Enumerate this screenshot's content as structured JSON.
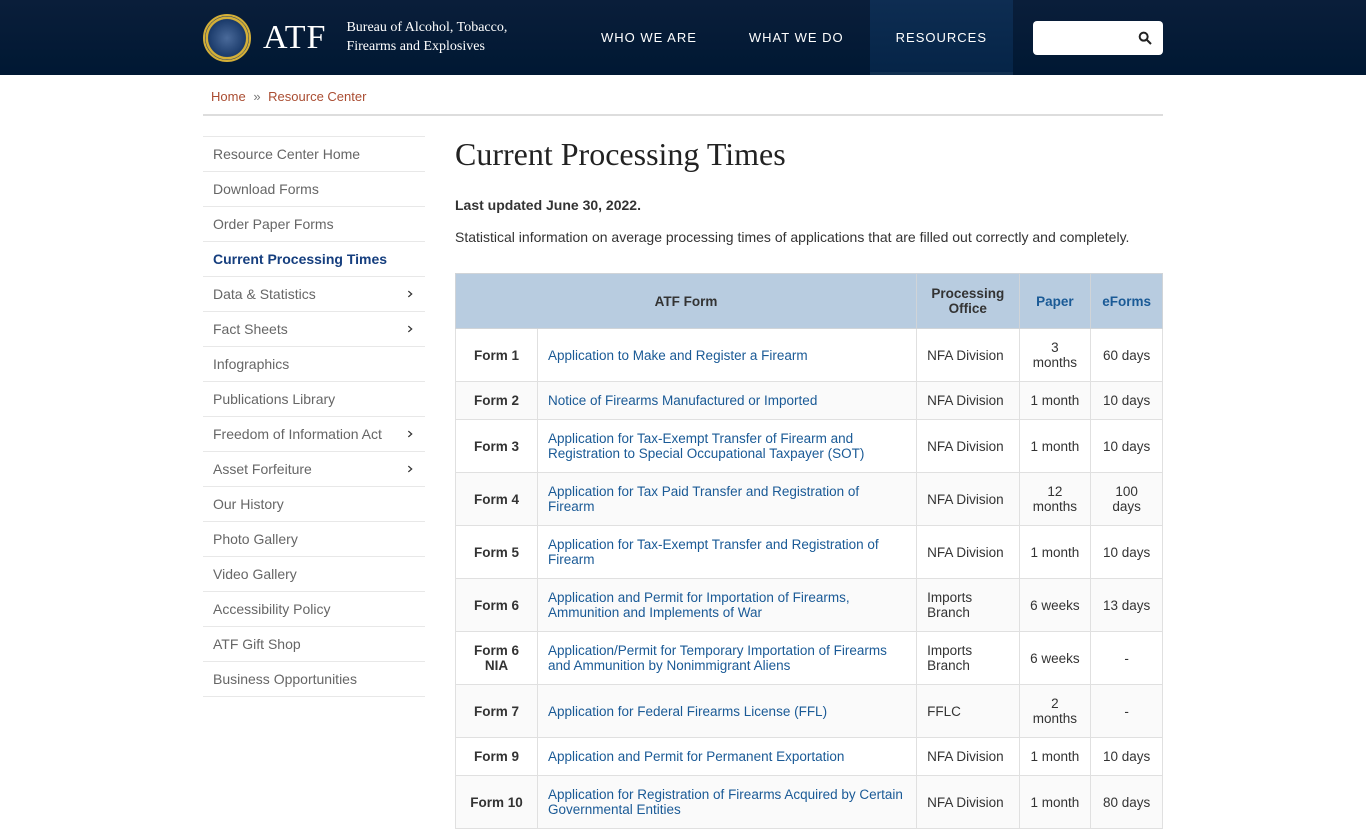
{
  "header": {
    "atf": "ATF",
    "bureau_line1": "Bureau of Alcohol, Tobacco,",
    "bureau_line2": "Firearms and Explosives",
    "nav": [
      {
        "label": "WHO WE ARE",
        "active": false
      },
      {
        "label": "WHAT WE DO",
        "active": false
      },
      {
        "label": "RESOURCES",
        "active": true
      }
    ],
    "search_placeholder": ""
  },
  "breadcrumb": {
    "home": "Home",
    "sep": "»",
    "current": "Resource Center"
  },
  "sidebar": {
    "items": [
      {
        "label": "Resource Center Home",
        "expand": false,
        "active": false
      },
      {
        "label": "Download Forms",
        "expand": false,
        "active": false
      },
      {
        "label": "Order Paper Forms",
        "expand": false,
        "active": false
      },
      {
        "label": "Current Processing Times",
        "expand": false,
        "active": true
      },
      {
        "label": "Data & Statistics",
        "expand": true,
        "active": false
      },
      {
        "label": "Fact Sheets",
        "expand": true,
        "active": false
      },
      {
        "label": "Infographics",
        "expand": false,
        "active": false
      },
      {
        "label": "Publications Library",
        "expand": false,
        "active": false
      },
      {
        "label": "Freedom of Information Act",
        "expand": true,
        "active": false
      },
      {
        "label": "Asset Forfeiture",
        "expand": true,
        "active": false
      },
      {
        "label": "Our History",
        "expand": false,
        "active": false
      },
      {
        "label": "Photo Gallery",
        "expand": false,
        "active": false
      },
      {
        "label": "Video Gallery",
        "expand": false,
        "active": false
      },
      {
        "label": "Accessibility Policy",
        "expand": false,
        "active": false
      },
      {
        "label": "ATF Gift Shop",
        "expand": false,
        "active": false
      },
      {
        "label": "Business Opportunities",
        "expand": false,
        "active": false
      }
    ]
  },
  "main": {
    "title": "Current Processing Times",
    "updated": "Last updated June 30, 2022.",
    "intro": "Statistical information on average processing times of applications that are filled out correctly and completely.",
    "columns": {
      "form": "ATF Form",
      "office": "Processing Office",
      "paper": "Paper",
      "eforms": "eForms"
    },
    "rows": [
      {
        "id": "Form 1",
        "desc": "Application to Make and Register a Firearm",
        "office": "NFA Division",
        "paper": "3 months",
        "eform": "60 days"
      },
      {
        "id": "Form 2",
        "desc": "Notice of Firearms Manufactured or Imported",
        "office": "NFA Division",
        "paper": "1 month",
        "eform": "10 days"
      },
      {
        "id": "Form 3",
        "desc": "Application for Tax-Exempt Transfer of Firearm and Registration to Special Occupational Taxpayer (SOT)",
        "office": "NFA Division",
        "paper": "1 month",
        "eform": "10 days"
      },
      {
        "id": "Form 4",
        "desc": "Application for Tax Paid Transfer and Registration of Firearm",
        "office": "NFA Division",
        "paper": "12 months",
        "eform": "100 days"
      },
      {
        "id": "Form 5",
        "desc": "Application for Tax-Exempt Transfer and Registration of Firearm",
        "office": "NFA Division",
        "paper": "1 month",
        "eform": "10 days"
      },
      {
        "id": "Form 6",
        "desc": "Application and Permit for Importation of Firearms, Ammunition and Implements of War",
        "office": "Imports Branch",
        "paper": "6 weeks",
        "eform": "13 days"
      },
      {
        "id": "Form 6 NIA",
        "desc": "Application/Permit for Temporary Importation of Firearms and Ammunition by Nonimmigrant Aliens",
        "office": "Imports Branch",
        "paper": "6 weeks",
        "eform": "-"
      },
      {
        "id": "Form 7",
        "desc": "Application for Federal Firearms License (FFL)",
        "office": "FFLC",
        "paper": "2 months",
        "eform": "-"
      },
      {
        "id": "Form 9",
        "desc": "Application and Permit for Permanent Exportation",
        "office": "NFA Division",
        "paper": "1 month",
        "eform": "10 days"
      },
      {
        "id": "Form 10",
        "desc": "Application for Registration of Firearms Acquired by Certain Governmental Entities",
        "office": "NFA Division",
        "paper": "1 month",
        "eform": "80 days"
      }
    ]
  }
}
